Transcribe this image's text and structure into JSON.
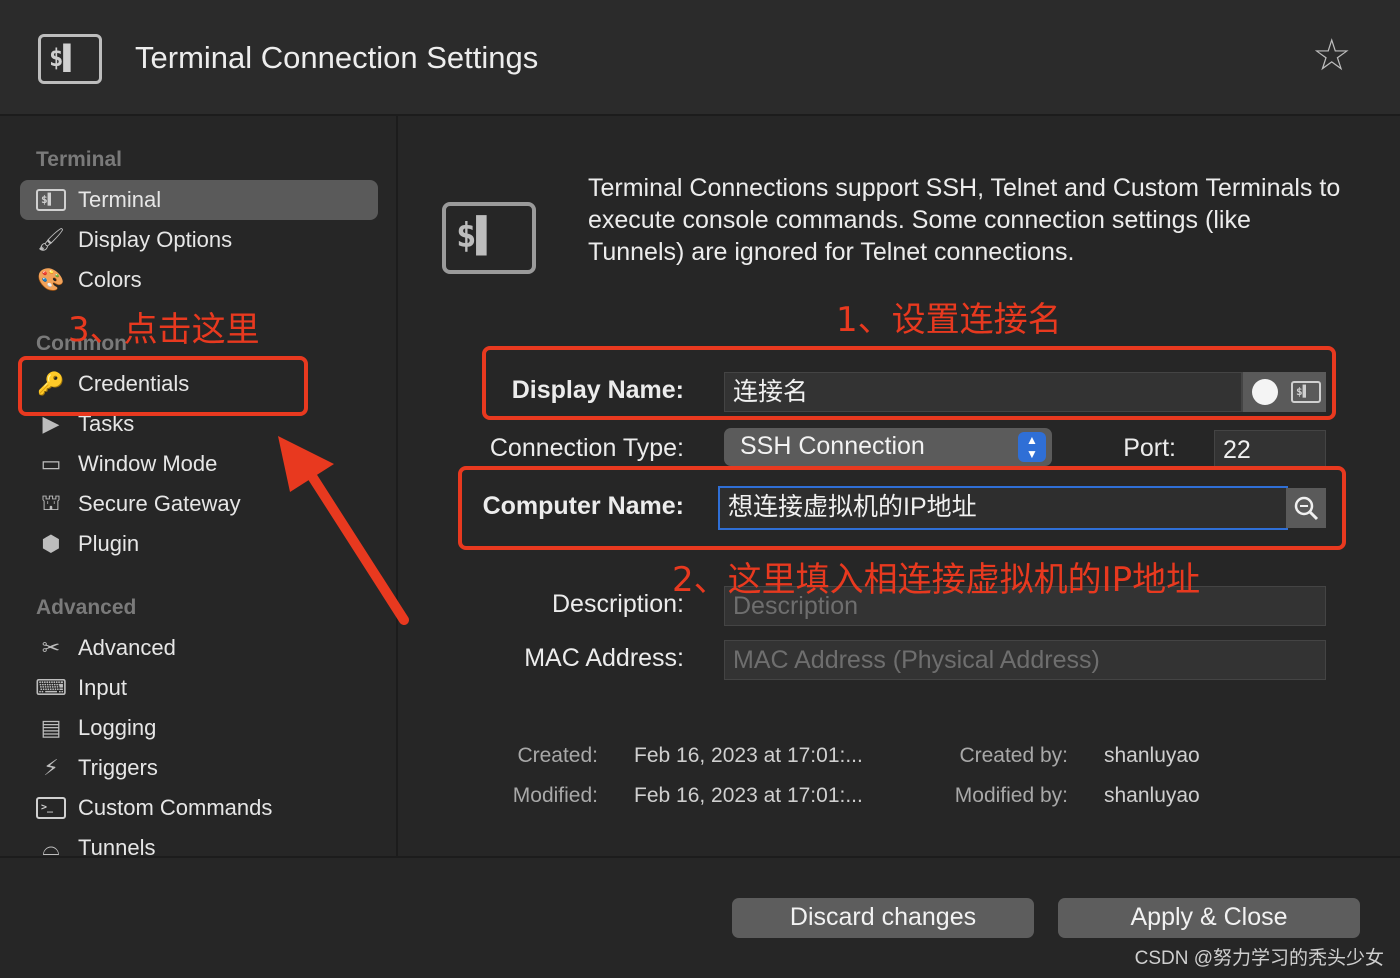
{
  "window": {
    "title": "Terminal Connection Settings"
  },
  "sidebar": {
    "sections": [
      {
        "heading": "Terminal",
        "items": [
          {
            "label": "Terminal",
            "icon": "terminal-icon",
            "active": true
          },
          {
            "label": "Display Options",
            "icon": "paint-brush-icon"
          },
          {
            "label": "Colors",
            "icon": "palette-icon"
          }
        ]
      },
      {
        "heading": "Common",
        "items": [
          {
            "label": "Credentials",
            "icon": "key-icon"
          },
          {
            "label": "Tasks",
            "icon": "tasks-icon"
          },
          {
            "label": "Window Mode",
            "icon": "window-icon"
          },
          {
            "label": "Secure Gateway",
            "icon": "gateway-icon"
          },
          {
            "label": "Plugin",
            "icon": "plugin-box-icon"
          }
        ]
      },
      {
        "heading": "Advanced",
        "items": [
          {
            "label": "Advanced",
            "icon": "tools-icon"
          },
          {
            "label": "Input",
            "icon": "keyboard-icon"
          },
          {
            "label": "Logging",
            "icon": "log-icon"
          },
          {
            "label": "Triggers",
            "icon": "triggers-icon"
          },
          {
            "label": "Custom Commands",
            "icon": "command-prompt-icon"
          },
          {
            "label": "Tunnels",
            "icon": "tunnel-icon"
          }
        ]
      }
    ]
  },
  "main": {
    "intro": "Terminal Connections support SSH, Telnet and Custom Terminals to execute console commands. Some connection settings (like Tunnels) are ignored for Telnet connections.",
    "display_name": {
      "label": "Display Name:",
      "value": "连接名"
    },
    "connection_type": {
      "label": "Connection Type:",
      "value": "SSH Connection"
    },
    "port": {
      "label": "Port:",
      "value": "22"
    },
    "computer_name": {
      "label": "Computer Name:",
      "value": "想连接虚拟机的IP地址"
    },
    "description": {
      "label": "Description:",
      "placeholder": "Description"
    },
    "mac_address": {
      "label": "MAC Address:",
      "placeholder": "MAC Address (Physical Address)"
    },
    "meta": {
      "created_label": "Created:",
      "created_value": "Feb 16, 2023 at 17:01:...",
      "modified_label": "Modified:",
      "modified_value": "Feb 16, 2023 at 17:01:...",
      "created_by_label": "Created by:",
      "created_by_value": "shanluyao",
      "modified_by_label": "Modified by:",
      "modified_by_value": "shanluyao"
    }
  },
  "annotations": {
    "step1": "1、设置连接名",
    "step2": "2、这里填入相连接虚拟机的IP地址",
    "step3": "3、点击这里",
    "color": "#e8391f"
  },
  "footer": {
    "discard_label": "Discard changes",
    "apply_label": "Apply & Close",
    "watermark": "CSDN @努力学习的秃头少女"
  },
  "colors": {
    "accent": "#2f6fd6",
    "background": "#262626",
    "active_item": "#5a5a5a"
  }
}
